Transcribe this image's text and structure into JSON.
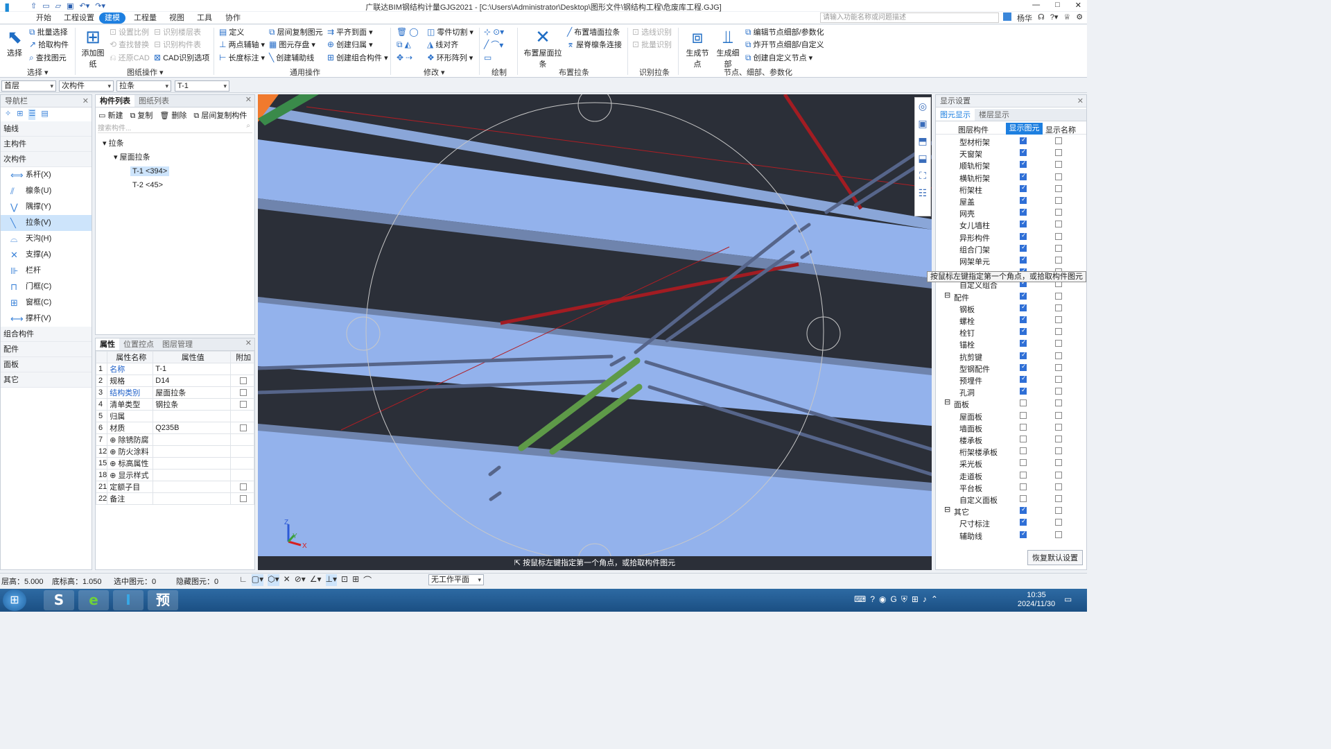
{
  "window": {
    "title": "广联达BIM钢结构计量GJG2021 - [C:\\Users\\Administrator\\Desktop\\图形文件\\钢结构工程\\危废库工程.GJG]"
  },
  "menu": [
    "开始",
    "工程设置",
    "建模",
    "工程量",
    "视图",
    "工具",
    "协作"
  ],
  "search": {
    "placeholder": "请输入功能名称或问题描述"
  },
  "user": {
    "name": "杨华"
  },
  "ribbon": {
    "select": {
      "big": "选择",
      "items": [
        "批量选择",
        "拾取构件",
        "查找图元"
      ],
      "group": "选择"
    },
    "drawing": {
      "big": "添加图纸",
      "items": [
        "设置比例",
        "查找替换",
        "还原CAD",
        "识别楼层表",
        "识别构件表",
        "CAD识别选项"
      ],
      "group": "图纸操作"
    },
    "common": {
      "items": [
        "定义",
        "两点辅轴",
        "长度标注",
        "层间复制图元",
        "图元存盘",
        "创建辅助线",
        "平齐到面",
        "创建归属",
        "创建组合构件"
      ],
      "group": "通用操作"
    },
    "modify": {
      "items": [
        "零件切割",
        "线对齐",
        "环形阵列"
      ],
      "group": "修改"
    },
    "draw": {
      "group": "绘制"
    },
    "layout": {
      "big": "布置屋面拉条",
      "items": [
        "布置墙面拉条",
        "屋脊檩条连接"
      ],
      "group": "布置拉条"
    },
    "recognize": {
      "items": [
        "选线识别",
        "批量识别"
      ],
      "group": "识别拉条"
    },
    "nodes": {
      "big1": "生成节点",
      "big2": "生成细部",
      "items": [
        "编辑节点细部/参数化",
        "炸开节点细部/自定义",
        "创建自定义节点"
      ],
      "group": "节点、细部、参数化"
    }
  },
  "context": {
    "floor": "首层",
    "type": "次构件",
    "sub": "拉条",
    "name": "T-1"
  },
  "nav": {
    "title": "导航栏",
    "cats": [
      "轴线",
      "主构件",
      "次构件"
    ],
    "items": [
      {
        "label": "系杆(X)",
        "icon": "tie-rod-icon"
      },
      {
        "label": "檩条(U)",
        "icon": "purlin-icon"
      },
      {
        "label": "隅撑(Y)",
        "icon": "knee-brace-icon"
      },
      {
        "label": "拉条(V)",
        "icon": "tie-bar-icon"
      },
      {
        "label": "天沟(H)",
        "icon": "gutter-icon"
      },
      {
        "label": "支撑(A)",
        "icon": "bracing-icon"
      },
      {
        "label": "栏杆",
        "icon": "railing-icon"
      },
      {
        "label": "门框(C)",
        "icon": "door-frame-icon"
      },
      {
        "label": "窗框(C)",
        "icon": "window-frame-icon"
      },
      {
        "label": "撑杆(V)",
        "icon": "strut-icon"
      }
    ],
    "cats2": [
      "组合构件",
      "配件",
      "面板",
      "其它"
    ]
  },
  "complist": {
    "tabs": [
      "构件列表",
      "图纸列表"
    ],
    "toolbar": [
      "新建",
      "复制",
      "删除",
      "层间复制构件"
    ],
    "search_placeholder": "搜索构件...",
    "tree": {
      "root": "拉条",
      "child": "屋面拉条",
      "items": [
        "T-1 <394>",
        "T-2 <45>"
      ]
    }
  },
  "props": {
    "tabs": [
      "属性",
      "位置控点",
      "图层管理"
    ],
    "headers": [
      "属性名称",
      "属性值",
      "附加"
    ],
    "rows": [
      {
        "n": "1",
        "name": "名称",
        "value": "T-1",
        "chk": null,
        "blue": true
      },
      {
        "n": "2",
        "name": "规格",
        "value": "D14",
        "chk": false,
        "blue": false
      },
      {
        "n": "3",
        "name": "结构类别",
        "value": "屋面拉条",
        "chk": false,
        "blue": true
      },
      {
        "n": "4",
        "name": "清单类型",
        "value": "钢拉条",
        "chk": false,
        "blue": false
      },
      {
        "n": "5",
        "name": "归属",
        "value": "",
        "chk": null,
        "blue": false
      },
      {
        "n": "6",
        "name": "材质",
        "value": "Q235B",
        "chk": false,
        "blue": false
      },
      {
        "n": "7",
        "name": "除锈防腐",
        "value": "",
        "chk": null,
        "blue": false,
        "exp": true
      },
      {
        "n": "12",
        "name": "防火涂料",
        "value": "",
        "chk": null,
        "blue": false,
        "exp": true
      },
      {
        "n": "15",
        "name": "标高属性",
        "value": "",
        "chk": null,
        "blue": false,
        "exp": true
      },
      {
        "n": "18",
        "name": "显示样式",
        "value": "",
        "chk": null,
        "blue": false,
        "exp": true
      },
      {
        "n": "21",
        "name": "定额子目",
        "value": "",
        "chk": false,
        "blue": false
      },
      {
        "n": "22",
        "name": "备注",
        "value": "",
        "chk": false,
        "blue": false
      }
    ]
  },
  "display": {
    "title": "显示设置",
    "tabs": [
      "图元显示",
      "楼层显示"
    ],
    "headers": [
      "图层构件",
      "显示图元",
      "显示名称"
    ],
    "rows": [
      {
        "label": "型材桁架",
        "show": true,
        "name": false,
        "level": 2
      },
      {
        "label": "天窗架",
        "show": true,
        "name": false,
        "level": 2
      },
      {
        "label": "顺轨桁架",
        "show": true,
        "name": false,
        "level": 2
      },
      {
        "label": "横轨桁架",
        "show": true,
        "name": false,
        "level": 2
      },
      {
        "label": "桁架柱",
        "show": true,
        "name": false,
        "level": 2
      },
      {
        "label": "屋盖",
        "show": true,
        "name": false,
        "level": 2
      },
      {
        "label": "网壳",
        "show": true,
        "name": false,
        "level": 2
      },
      {
        "label": "女儿墙柱",
        "show": true,
        "name": false,
        "level": 2
      },
      {
        "label": "异形构件",
        "show": true,
        "name": false,
        "level": 2
      },
      {
        "label": "组合门架",
        "show": true,
        "name": false,
        "level": 2
      },
      {
        "label": "网架单元",
        "show": true,
        "name": false,
        "level": 2
      },
      {
        "label": "",
        "show": true,
        "name": false,
        "level": 2
      },
      {
        "label": "自定义组合",
        "show": true,
        "name": false,
        "level": 2
      },
      {
        "label": "配件",
        "show": true,
        "name": false,
        "level": 1
      },
      {
        "label": "钢板",
        "show": true,
        "name": false,
        "level": 2
      },
      {
        "label": "螺栓",
        "show": true,
        "name": false,
        "level": 2
      },
      {
        "label": "栓钉",
        "show": true,
        "name": false,
        "level": 2
      },
      {
        "label": "锚栓",
        "show": true,
        "name": false,
        "level": 2
      },
      {
        "label": "抗剪键",
        "show": true,
        "name": false,
        "level": 2
      },
      {
        "label": "型钢配件",
        "show": true,
        "name": false,
        "level": 2
      },
      {
        "label": "预埋件",
        "show": true,
        "name": false,
        "level": 2
      },
      {
        "label": "孔洞",
        "show": true,
        "name": false,
        "level": 2
      },
      {
        "label": "面板",
        "show": false,
        "name": false,
        "level": 1
      },
      {
        "label": "屋面板",
        "show": false,
        "name": false,
        "level": 2
      },
      {
        "label": "墙面板",
        "show": false,
        "name": false,
        "level": 2
      },
      {
        "label": "楼承板",
        "show": false,
        "name": false,
        "level": 2
      },
      {
        "label": "桁架楼承板",
        "show": false,
        "name": false,
        "level": 2
      },
      {
        "label": "采光板",
        "show": false,
        "name": false,
        "level": 2
      },
      {
        "label": "走道板",
        "show": false,
        "name": false,
        "level": 2
      },
      {
        "label": "平台板",
        "show": false,
        "name": false,
        "level": 2
      },
      {
        "label": "自定义面板",
        "show": false,
        "name": false,
        "level": 2
      },
      {
        "label": "其它",
        "show": true,
        "name": false,
        "level": 1
      },
      {
        "label": "尺寸标注",
        "show": true,
        "name": false,
        "level": 2
      },
      {
        "label": "辅助线",
        "show": true,
        "name": false,
        "level": 2
      }
    ],
    "restore": "恢复默认设置"
  },
  "viewport": {
    "hint": "按鼠标左键指定第一个角点，或拾取构件图元",
    "tooltip": "按鼠标左键指定第一个角点，或拾取构件图元",
    "axes": {
      "x": "X",
      "y": "Y",
      "z": "Z"
    }
  },
  "status": {
    "floor_h": "层高：5.000",
    "base_h": "底标高：1.050",
    "selected": "选中图元：0",
    "hidden": "隐藏图元：0",
    "plane": "无工作平面"
  },
  "taskbar": {
    "time": "10:35",
    "date": "2024/11/30",
    "apps": [
      "S",
      "e",
      "I",
      "预"
    ]
  },
  "colors": {
    "accent": "#1d7fe0",
    "purlin": "#93b2ec",
    "tiebar": "#5a6a8f",
    "selected": "#5e9a48",
    "red": "#b01e24"
  }
}
